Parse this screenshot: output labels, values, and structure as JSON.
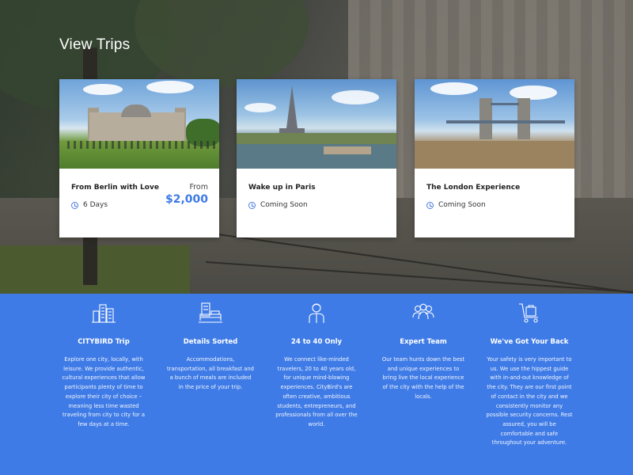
{
  "section_title": "View Trips",
  "trips": [
    {
      "name": "From Berlin with Love",
      "duration": "6 Days",
      "from_label": "From",
      "price": "$2,000"
    },
    {
      "name": "Wake up in Paris",
      "duration": "Coming Soon"
    },
    {
      "name": "The London Experience",
      "duration": "Coming Soon"
    }
  ],
  "features": [
    {
      "icon": "city-buildings-icon",
      "title": "CITYBIRD Trip",
      "description": "Explore one city, locally, with leisure. We provide authentic, cultural experiences that allow participants plenty of time to explore their city of choice – meaning less time wasted traveling from city to city for a few days at a time."
    },
    {
      "icon": "hotel-bed-icon",
      "title": "Details Sorted",
      "description": "Accommodations, transportation, all breakfast and a bunch of meals are included in the price of your trip."
    },
    {
      "icon": "person-icon",
      "title": "24 to 40 Only",
      "description": "We connect like-minded travelers, 20 to 40 years old, for unique mind-blowing experiences. CityBird's are often creative, ambitious students, entrepreneurs, and professionals from all over the world."
    },
    {
      "icon": "team-icon",
      "title": "Expert Team",
      "description": "Our team hunts down the best and unique experiences to bring live the local experience of the city with the help of the locals."
    },
    {
      "icon": "luggage-cart-icon",
      "title": "We've Got Your Back",
      "description": "Your safety is very important to us. We use the hippest guide with in-and-out knowledge of the city. They are our first point of contact in the city and we consistently monitor any possible security concerns. Rest assured, you will be comfortable and safe throughout your adventure."
    }
  ],
  "colors": {
    "accent": "#3f7be6",
    "price": "#3d7ae6",
    "card_text": "#222222"
  }
}
